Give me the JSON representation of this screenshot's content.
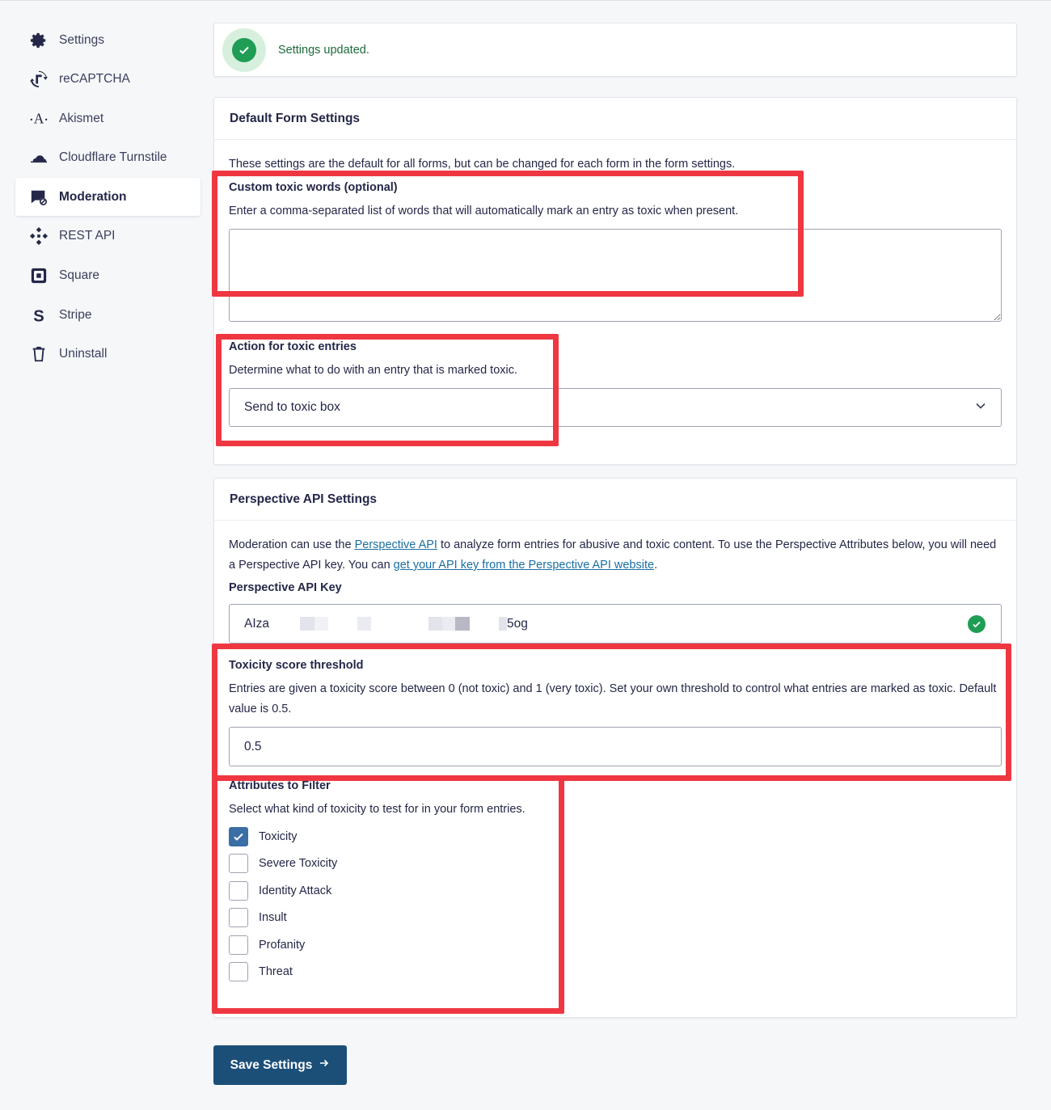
{
  "sidebar": {
    "items": [
      {
        "label": "Settings",
        "icon": "gear-icon"
      },
      {
        "label": "reCAPTCHA",
        "icon": "recaptcha-icon"
      },
      {
        "label": "Akismet",
        "icon": "akismet-icon"
      },
      {
        "label": "Cloudflare Turnstile",
        "icon": "cloud-icon"
      },
      {
        "label": "Moderation",
        "icon": "moderation-icon",
        "active": true
      },
      {
        "label": "REST API",
        "icon": "api-icon"
      },
      {
        "label": "Square",
        "icon": "square-icon"
      },
      {
        "label": "Stripe",
        "icon": "stripe-icon"
      },
      {
        "label": "Uninstall",
        "icon": "trash-icon"
      }
    ]
  },
  "notice": {
    "text": "Settings updated."
  },
  "default_form": {
    "title": "Default Form Settings",
    "description": "These settings are the default for all forms, but can be changed for each form in the form settings.",
    "toxic_words": {
      "label": "Custom toxic words (optional)",
      "description": "Enter a comma-separated list of words that will automatically mark an entry as toxic when present.",
      "value": ""
    },
    "action": {
      "label": "Action for toxic entries",
      "description": "Determine what to do with an entry that is marked toxic.",
      "value": "Send to toxic box"
    }
  },
  "perspective": {
    "title": "Perspective API Settings",
    "intro_1": "Moderation can use the ",
    "intro_link_1": "Perspective API",
    "intro_2": " to analyze form entries for abusive and toxic content. To use the Perspective Attributes below, you will need a Perspective API key. You can ",
    "intro_link_2": "get your API key from the Perspective API website",
    "intro_3": ".",
    "api_key": {
      "label": "Perspective API Key",
      "value_start": "AIza",
      "value_end": "5og"
    },
    "threshold": {
      "label": "Toxicity score threshold",
      "description": "Entries are given a toxicity score between 0 (not toxic) and 1 (very toxic). Set your own threshold to control what entries are marked as toxic. Default value is 0.5.",
      "value": "0.5"
    },
    "attributes": {
      "label": "Attributes to Filter",
      "description": "Select what kind of toxicity to test for in your form entries.",
      "options": [
        {
          "label": "Toxicity",
          "checked": true
        },
        {
          "label": "Severe Toxicity",
          "checked": false
        },
        {
          "label": "Identity Attack",
          "checked": false
        },
        {
          "label": "Insult",
          "checked": false
        },
        {
          "label": "Profanity",
          "checked": false
        },
        {
          "label": "Threat",
          "checked": false
        }
      ]
    }
  },
  "save_button": {
    "label": "Save Settings"
  },
  "colors": {
    "highlight": "#ef3742",
    "primary": "#1c4f78",
    "success": "#1f9d55"
  }
}
